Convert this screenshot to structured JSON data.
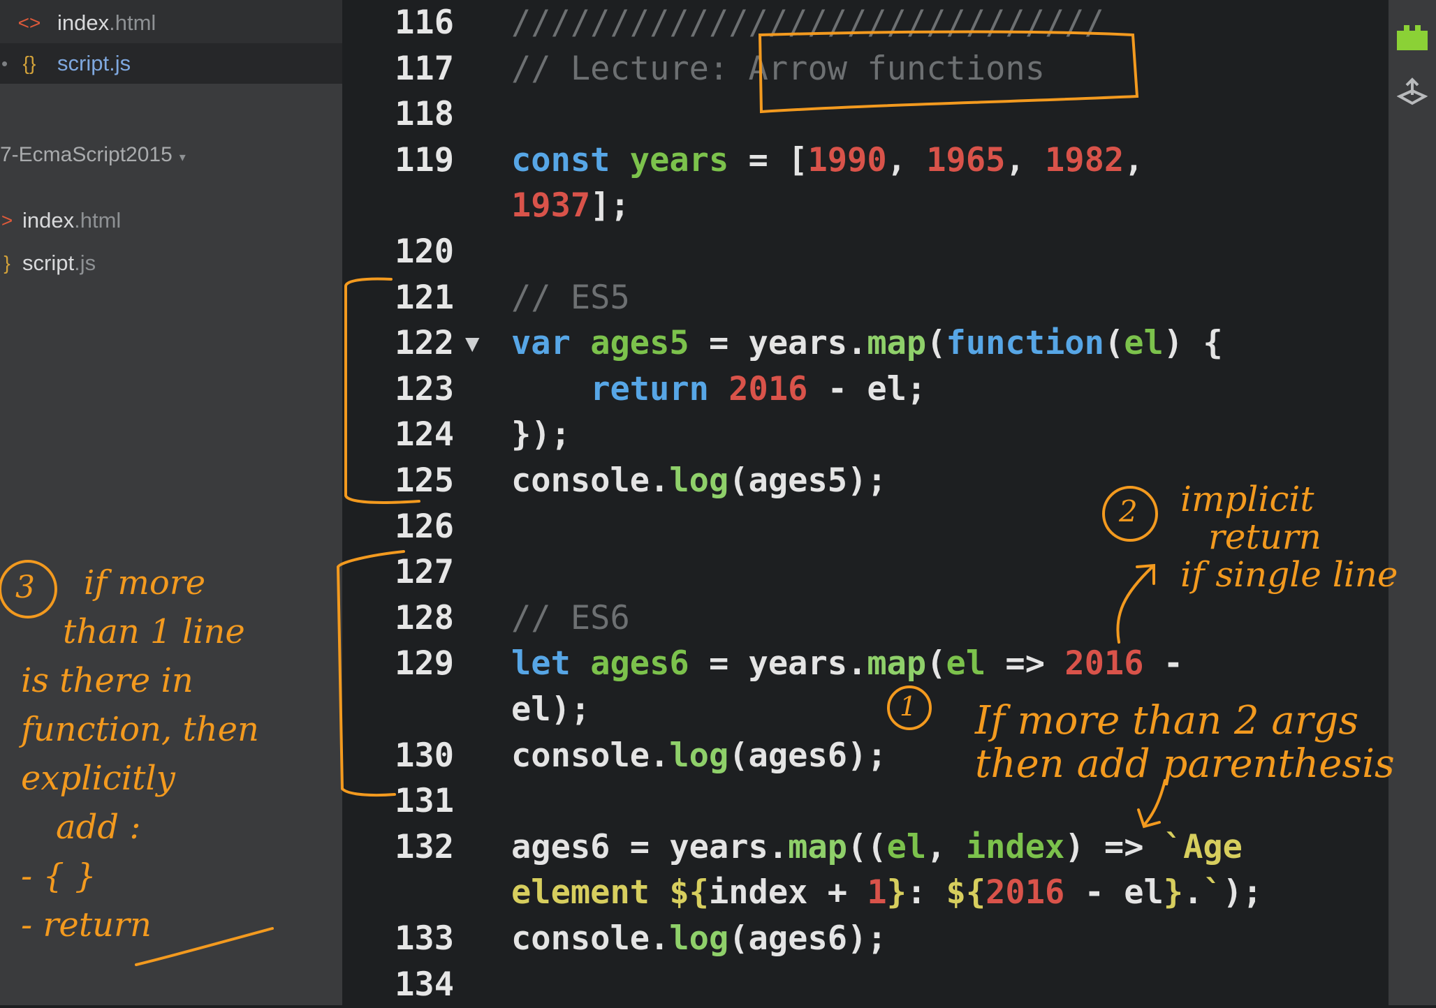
{
  "sidebar": {
    "open_files": [
      {
        "icon": "<>",
        "name": "index",
        "ext": ".html",
        "type": "html"
      },
      {
        "icon": "{}",
        "name": "script",
        "ext": ".js",
        "type": "js"
      }
    ],
    "project_name": "7-EcmaScript2015",
    "project_caret": "▾",
    "tree_files": [
      {
        "icon": ">",
        "name": "index",
        "ext": ".html"
      },
      {
        "icon": "}",
        "name": "script",
        "ext": ".js"
      }
    ],
    "bullet": "•"
  },
  "editor": {
    "line_numbers": [
      "116",
      "117",
      "118",
      "119",
      "",
      "120",
      "121",
      "122",
      "123",
      "124",
      "125",
      "126",
      "127",
      "128",
      "129",
      "",
      "130",
      "131",
      "132",
      "",
      "133",
      "134"
    ],
    "fold_marker": "▼",
    "lines": [
      {
        "t": [
          [
            "c-cm",
            "//////////////////////////////"
          ]
        ]
      },
      {
        "t": [
          [
            "c-cm",
            "// Lecture: Arrow functions"
          ]
        ]
      },
      {
        "t": []
      },
      {
        "t": [
          [
            "c-kw",
            "const"
          ],
          [
            "c-pl",
            " "
          ],
          [
            "c-var",
            "years"
          ],
          [
            "c-pl",
            " = ["
          ],
          [
            "c-num",
            "1990"
          ],
          [
            "c-pl",
            ", "
          ],
          [
            "c-num",
            "1965"
          ],
          [
            "c-pl",
            ", "
          ],
          [
            "c-num",
            "1982"
          ],
          [
            "c-pl",
            ","
          ]
        ]
      },
      {
        "t": [
          [
            "c-num",
            "1937"
          ],
          [
            "c-pl",
            "];"
          ]
        ]
      },
      {
        "t": []
      },
      {
        "t": [
          [
            "c-cm",
            "// ES5"
          ]
        ]
      },
      {
        "t": [
          [
            "c-kw",
            "var"
          ],
          [
            "c-pl",
            " "
          ],
          [
            "c-var",
            "ages5"
          ],
          [
            "c-pl",
            " = years."
          ],
          [
            "c-fn",
            "map"
          ],
          [
            "c-pl",
            "("
          ],
          [
            "c-kw",
            "function"
          ],
          [
            "c-pl",
            "("
          ],
          [
            "c-var",
            "el"
          ],
          [
            "c-pl",
            ") {"
          ]
        ]
      },
      {
        "t": [
          [
            "c-pl",
            "    "
          ],
          [
            "c-kw",
            "return"
          ],
          [
            "c-pl",
            " "
          ],
          [
            "c-num",
            "2016"
          ],
          [
            "c-pl",
            " - el;"
          ]
        ]
      },
      {
        "t": [
          [
            "c-pl",
            "});"
          ]
        ]
      },
      {
        "t": [
          [
            "c-pl",
            "console."
          ],
          [
            "c-fn",
            "log"
          ],
          [
            "c-pl",
            "(ages5);"
          ]
        ]
      },
      {
        "t": []
      },
      {
        "t": []
      },
      {
        "t": [
          [
            "c-cm",
            "// ES6"
          ]
        ]
      },
      {
        "t": [
          [
            "c-kw",
            "let"
          ],
          [
            "c-pl",
            " "
          ],
          [
            "c-var",
            "ages6"
          ],
          [
            "c-pl",
            " = years."
          ],
          [
            "c-fn",
            "map"
          ],
          [
            "c-pl",
            "("
          ],
          [
            "c-var",
            "el"
          ],
          [
            "c-pl",
            " => "
          ],
          [
            "c-num",
            "2016"
          ],
          [
            "c-pl",
            " -"
          ]
        ]
      },
      {
        "t": [
          [
            "c-pl",
            "el);"
          ]
        ]
      },
      {
        "t": [
          [
            "c-pl",
            "console."
          ],
          [
            "c-fn",
            "log"
          ],
          [
            "c-pl",
            "(ages6);"
          ]
        ]
      },
      {
        "t": []
      },
      {
        "t": [
          [
            "c-pl",
            "ages6 = years."
          ],
          [
            "c-fn",
            "map"
          ],
          [
            "c-pl",
            "(("
          ],
          [
            "c-var",
            "el"
          ],
          [
            "c-pl",
            ", "
          ],
          [
            "c-var",
            "index"
          ],
          [
            "c-pl",
            ") => "
          ],
          [
            "c-str",
            "`Age"
          ]
        ]
      },
      {
        "t": [
          [
            "c-str",
            "element "
          ],
          [
            "c-str",
            "${"
          ],
          [
            "c-pl",
            "index + "
          ],
          [
            "c-num",
            "1"
          ],
          [
            "c-str",
            "}"
          ],
          [
            "c-pl",
            ": "
          ],
          [
            "c-str",
            "${"
          ],
          [
            "c-num",
            "2016"
          ],
          [
            "c-pl",
            " - el"
          ],
          [
            "c-str",
            "}"
          ],
          [
            "c-pl",
            "."
          ],
          [
            "c-str",
            "`"
          ],
          [
            "c-pl",
            ");"
          ]
        ]
      },
      {
        "t": [
          [
            "c-pl",
            "console."
          ],
          [
            "c-fn",
            "log"
          ],
          [
            "c-pl",
            "(ages6);"
          ]
        ]
      },
      {
        "t": []
      }
    ]
  },
  "rail": {
    "icon1": "extension-icon",
    "icon2": "deploy-icon"
  },
  "annotations": {
    "note1_number": "1",
    "note1_text": [
      "If more than 2 args",
      "then add parenthesis"
    ],
    "note2_number": "2",
    "note2_text": [
      "implicit",
      "return",
      "if single line"
    ],
    "note3_number": "3",
    "note3_text": [
      "if more",
      "than 1 line",
      "is there in",
      "function, then",
      "explicitly",
      "add :",
      "- { }",
      "- return"
    ],
    "color": "#f39a1f"
  }
}
